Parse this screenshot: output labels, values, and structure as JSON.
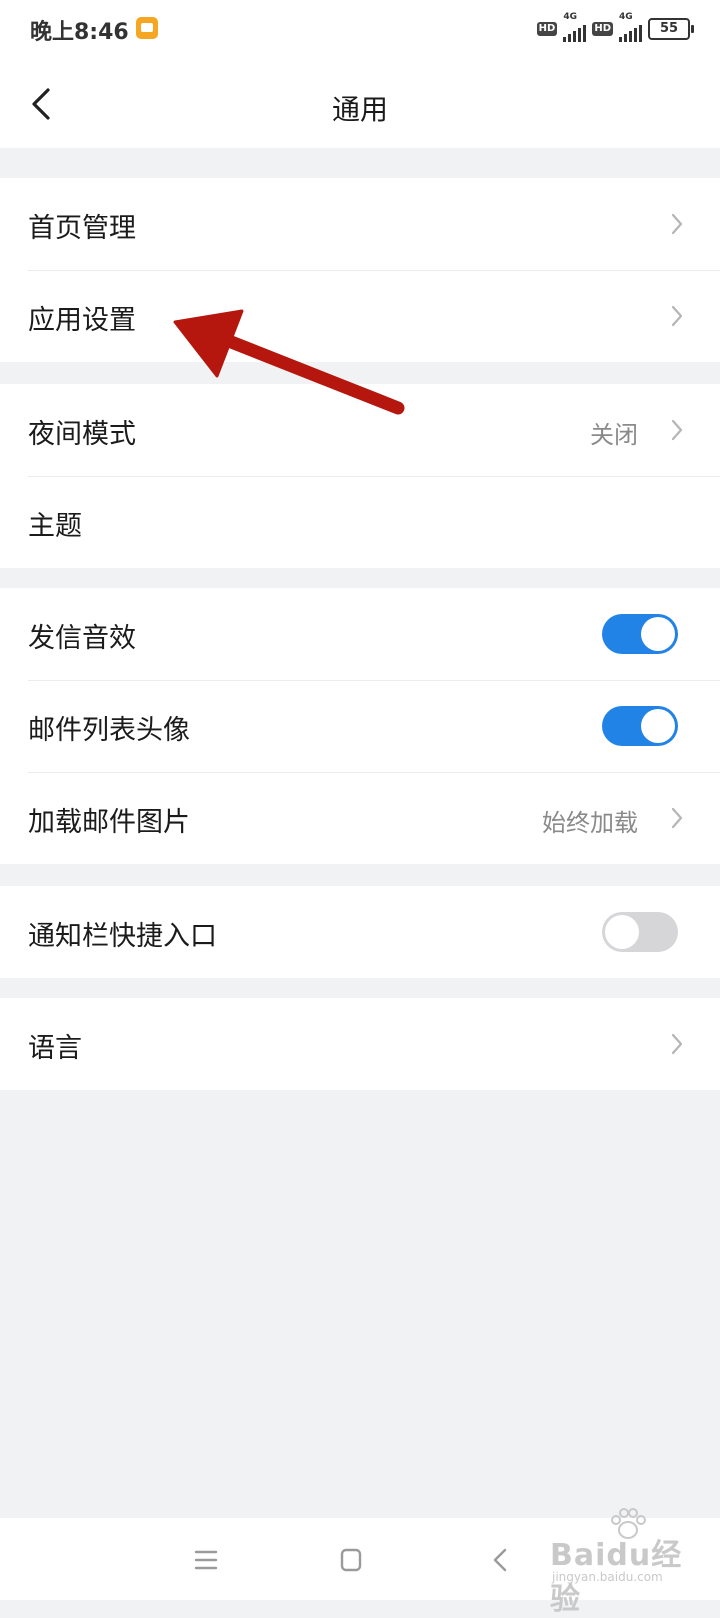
{
  "status_bar": {
    "time": "晚上8:46",
    "hd1": "HD",
    "net1": "4G",
    "hd2": "HD",
    "net2": "4G",
    "battery": "55"
  },
  "header": {
    "title": "通用"
  },
  "groups": {
    "g1": {
      "home_manage": "首页管理",
      "app_settings": "应用设置"
    },
    "g2": {
      "night_mode": "夜间模式",
      "night_mode_value": "关闭",
      "theme": "主题"
    },
    "g3": {
      "send_sound": "发信音效",
      "send_sound_on": true,
      "list_avatar": "邮件列表头像",
      "list_avatar_on": true,
      "load_images": "加载邮件图片",
      "load_images_value": "始终加载"
    },
    "g4": {
      "notify_shortcut": "通知栏快捷入口",
      "notify_shortcut_on": false
    },
    "g5": {
      "language": "语言"
    }
  },
  "annotation_color": "#b5170f",
  "toggle_on_color": "#2283e6",
  "watermark": {
    "main": "Baidu经验",
    "url": "jingyan.baidu.com"
  }
}
